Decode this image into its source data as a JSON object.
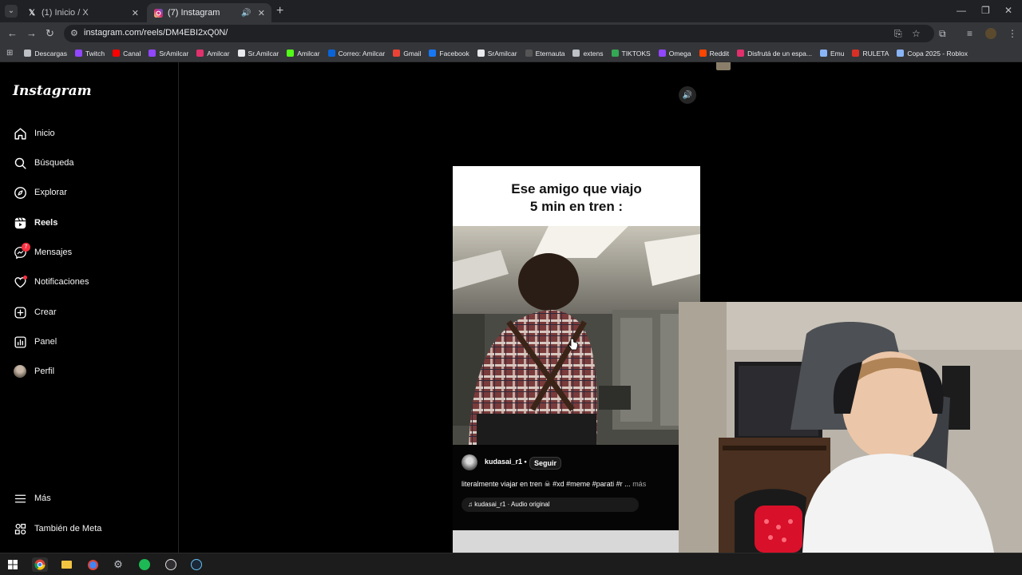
{
  "browser": {
    "tabs": [
      {
        "title": "(1) Inicio / X",
        "icon": "x-logo-icon",
        "active": false
      },
      {
        "title": "(7) Instagram",
        "icon": "instagram-logo-icon",
        "active": true
      }
    ],
    "url": "instagram.com/reels/DM4EBI2xQ0N/",
    "bookmarks": [
      {
        "label": "Descargas",
        "icon": "download-icon",
        "color": "#bdc1c6"
      },
      {
        "label": "Twitch",
        "icon": "twitch-icon",
        "color": "#9146ff"
      },
      {
        "label": "Canal",
        "icon": "youtube-icon",
        "color": "#ff0000"
      },
      {
        "label": "SrAmilcar",
        "icon": "twitch-icon",
        "color": "#9146ff"
      },
      {
        "label": "Amilcar",
        "icon": "instagram-icon",
        "color": "#e1306c"
      },
      {
        "label": "Sr.Amilcar",
        "icon": "x-icon",
        "color": "#e8eaed"
      },
      {
        "label": "Amilcar",
        "icon": "kick-icon",
        "color": "#53fc18"
      },
      {
        "label": "Correo: Amilcar",
        "icon": "outlook-icon",
        "color": "#0a64d8"
      },
      {
        "label": "Gmail",
        "icon": "gmail-icon",
        "color": "#ea4335"
      },
      {
        "label": "Facebook",
        "icon": "facebook-icon",
        "color": "#1877f2"
      },
      {
        "label": "SrAmilcar",
        "icon": "tiktok-icon",
        "color": "#e8eaed"
      },
      {
        "label": "Eternauta",
        "icon": "netflix-icon",
        "color": "#555555"
      },
      {
        "label": "extens",
        "icon": "extension-icon",
        "color": "#bdc1c6"
      },
      {
        "label": "TIKTOKS",
        "icon": "drive-icon",
        "color": "#34a853"
      },
      {
        "label": "Omega",
        "icon": "twitch-icon",
        "color": "#9146ff"
      },
      {
        "label": "Reddit",
        "icon": "reddit-icon",
        "color": "#ff4500"
      },
      {
        "label": "Disfrutá de un espa...",
        "icon": "brand-icon",
        "color": "#e1306c"
      },
      {
        "label": "Emu",
        "icon": "emulator-icon",
        "color": "#8ab4f8"
      },
      {
        "label": "RULETA",
        "icon": "roulette-icon",
        "color": "#d93025"
      },
      {
        "label": "Copa 2025 - Roblox",
        "icon": "roblox-icon",
        "color": "#8ab4f8"
      }
    ]
  },
  "instagram": {
    "logo": "Instagram",
    "nav": [
      {
        "label": "Inicio",
        "icon": "home-icon",
        "bold": false
      },
      {
        "label": "Búsqueda",
        "icon": "search-icon",
        "bold": false
      },
      {
        "label": "Explorar",
        "icon": "compass-icon",
        "bold": false
      },
      {
        "label": "Reels",
        "icon": "reels-icon",
        "bold": true
      },
      {
        "label": "Mensajes",
        "icon": "messenger-icon",
        "bold": false,
        "badge": "7"
      },
      {
        "label": "Notificaciones",
        "icon": "heart-icon",
        "bold": false,
        "dot": true
      },
      {
        "label": "Crear",
        "icon": "plus-square-icon",
        "bold": false
      },
      {
        "label": "Panel",
        "icon": "dashboard-icon",
        "bold": false
      },
      {
        "label": "Perfil",
        "icon": "profile-avatar-icon",
        "bold": false
      }
    ],
    "more_label": "Más",
    "meta_label": "También de Meta",
    "reel": {
      "caption_line1": "Ese amigo que viajo",
      "caption_line2": "5 min en tren :",
      "author": "kudasai_r1",
      "separator": "•",
      "follow_label": "Seguir",
      "description": "literalmente viajar en tren ☠ #xd #meme #parati #r ...",
      "more_label": "más",
      "audio": "kudasai_r1 · Audio original"
    }
  },
  "colors": {
    "accent_red": "#ff3040",
    "chrome_dark": "#202124",
    "chrome_toolbar": "#35363a"
  }
}
